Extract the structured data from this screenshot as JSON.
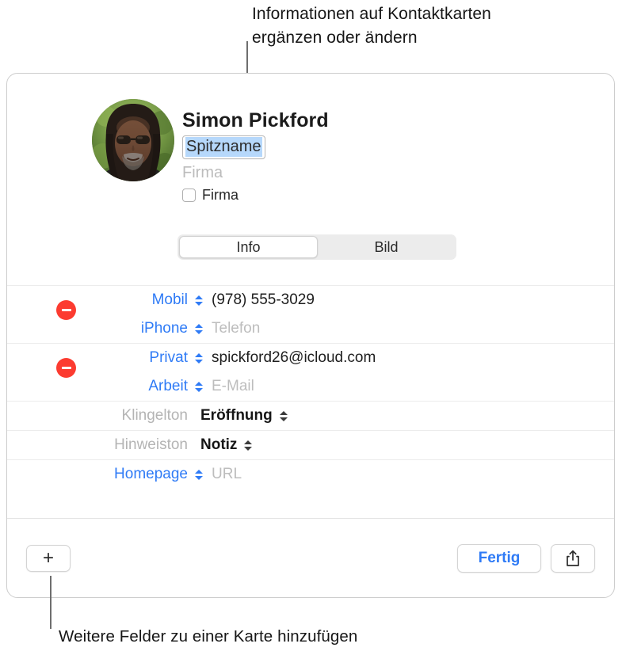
{
  "annotations": {
    "top_callout": "Informationen auf Kontaktkarten\nergänzen oder ändern",
    "bottom_callout": "Weitere Felder zu einer Karte hinzufügen"
  },
  "card": {
    "header": {
      "full_name": "Simon  Pickford",
      "first_name": "Simon",
      "last_name": "Pickford",
      "nickname_placeholder": "Spitzname",
      "company_placeholder": "Firma",
      "company_checkbox_label": "Firma",
      "avatar_name": "contact-photo"
    },
    "tabs": [
      {
        "label": "Info",
        "selected": true
      },
      {
        "label": "Bild",
        "selected": false
      }
    ],
    "fields": [
      {
        "removable": true,
        "rows": [
          {
            "label": "Mobil",
            "label_style": "link",
            "stepper": true,
            "value": "(978) 555-3029",
            "value_style": "normal"
          },
          {
            "label": "iPhone",
            "label_style": "link",
            "stepper": true,
            "value": "Telefon",
            "value_style": "placeholder"
          }
        ]
      },
      {
        "removable": true,
        "rows": [
          {
            "label": "Privat",
            "label_style": "link",
            "stepper": true,
            "value": "spickford26@icloud.com",
            "value_style": "normal"
          },
          {
            "label": "Arbeit",
            "label_style": "link",
            "stepper": true,
            "value": "E-Mail",
            "value_style": "placeholder"
          }
        ]
      },
      {
        "removable": false,
        "rows": [
          {
            "label": "Klingelton",
            "label_style": "muted",
            "stepper": false,
            "value": "Eröffnung",
            "value_style": "bold",
            "value_stepper": true
          }
        ]
      },
      {
        "removable": false,
        "rows": [
          {
            "label": "Hinweiston",
            "label_style": "muted",
            "stepper": false,
            "value": "Notiz",
            "value_style": "bold",
            "value_stepper": true
          }
        ]
      },
      {
        "removable": false,
        "rows": [
          {
            "label": "Homepage",
            "label_style": "link",
            "stepper": true,
            "value": "URL",
            "value_style": "placeholder"
          }
        ]
      }
    ],
    "toolbar": {
      "add_label": "+",
      "done_label": "Fertig",
      "share_icon": "share-icon"
    }
  },
  "colors": {
    "accent_blue": "#2f7bf6",
    "delete_red": "#fc3b30",
    "selection_blue": "#b6d8fb",
    "muted_gray": "#b4b4b4"
  }
}
